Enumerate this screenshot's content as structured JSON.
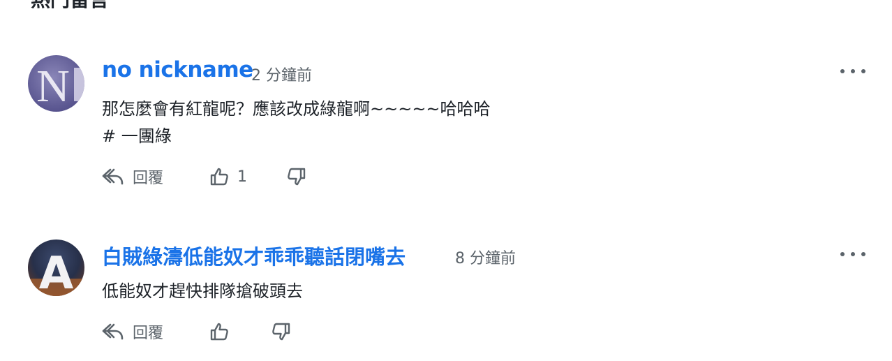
{
  "section": {
    "title": "熱門留言"
  },
  "comments": [
    {
      "author": "no nickname",
      "time": "2 分鐘前",
      "lines": [
        "那怎麼會有紅龍呢？應該改成綠龍啊~~~~~哈哈哈",
        "# 一團綠"
      ],
      "avatar_letter": "N",
      "reply_label": "回覆",
      "like_count": "1",
      "icons": [
        "reply-icon",
        "thumbs-up-icon",
        "thumbs-down-icon",
        "more-options-icon"
      ]
    },
    {
      "author": "白賊綠濤低能奴才乖乖聽話閉嘴去",
      "time": "8 分鐘前",
      "lines": [
        "低能奴才趕快排隊搶破頭去"
      ],
      "avatar_letter": "A",
      "reply_label": "回覆",
      "like_count": "",
      "icons": [
        "reply-icon",
        "thumbs-up-icon",
        "thumbs-down-icon",
        "more-options-icon"
      ]
    }
  ],
  "colors": {
    "author": "#1a73e8",
    "muted": "#5b636a",
    "text": "#1d2228"
  }
}
